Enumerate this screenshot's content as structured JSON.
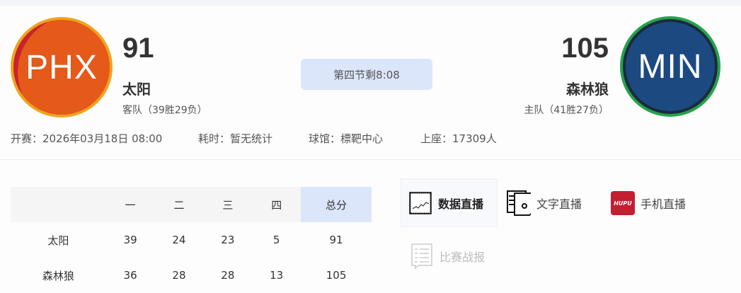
{
  "away": {
    "abbr": "PHX",
    "score": "91",
    "name": "太阳",
    "record": "客队（39胜29负）"
  },
  "home": {
    "abbr": "MIN",
    "score": "105",
    "name": "森林狼",
    "record": "主队（41胜27负）"
  },
  "status": "第四节剩8:08",
  "info": {
    "start": "开赛：2026年03月18日 08:00",
    "duration": "耗时：暂无统计",
    "venue": "球馆：標靶中心",
    "attendance": "上座：17309人"
  },
  "table": {
    "headers": [
      "",
      "一",
      "二",
      "三",
      "四",
      "总分"
    ],
    "rows": [
      [
        "太阳",
        "39",
        "24",
        "23",
        "5",
        "91"
      ],
      [
        "森林狼",
        "36",
        "28",
        "28",
        "13",
        "105"
      ]
    ]
  },
  "tabs": [
    {
      "label": "数据直播",
      "icon": "chart-icon"
    },
    {
      "label": "文字直播",
      "icon": "text-doc-icon"
    },
    {
      "label": "手机直播",
      "icon": "hupu-icon",
      "icon_text": "HUPU"
    },
    {
      "label": "比赛战报",
      "icon": "report-icon"
    }
  ],
  "colors": {
    "accent": "#dce6fb",
    "hupu": "#c41e32"
  }
}
